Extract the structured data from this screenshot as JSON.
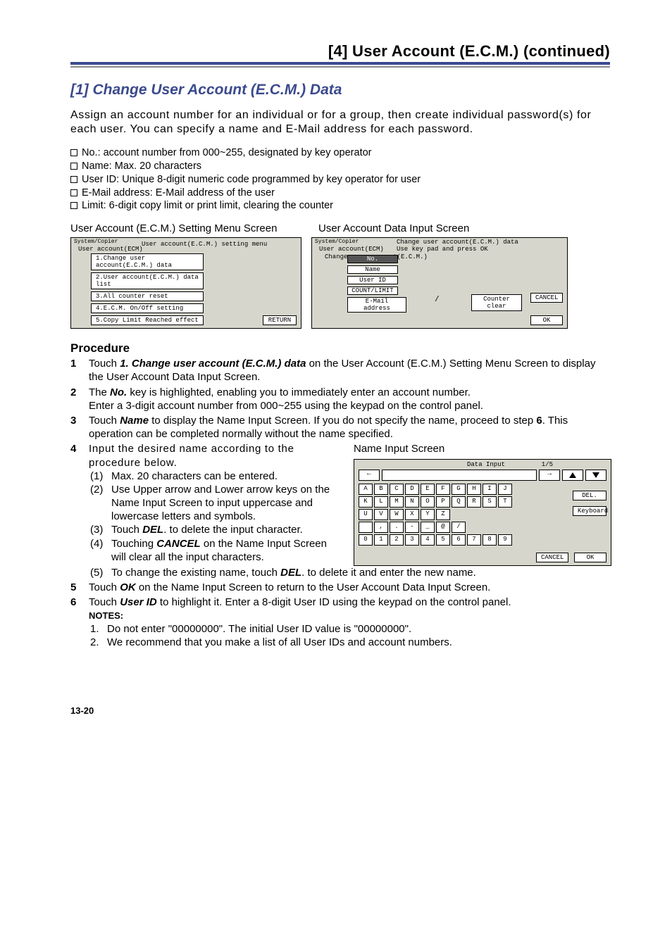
{
  "header": {
    "title": "[4] User Account (E.C.M.) (continued)"
  },
  "section_title": "[1] Change User Account (E.C.M.) Data",
  "intro": "Assign an account number for an individual or for a group, then create individual password(s) for each user. You can specify a name and E-Mail address for each password.",
  "bullets": [
    "No.: account number from 000~255, designated by key operator",
    "Name: Max. 20 characters",
    "User ID: Unique 8-digit numeric code programmed by key operator for user",
    "E-Mail address: E-Mail address of the user",
    "Limit: 6-digit copy limit or print limit, clearing the counter"
  ],
  "screen_labels": {
    "left": "User Account (E.C.M.) Setting Menu Screen",
    "right": "User Account Data Input Screen"
  },
  "screen1": {
    "bc1": "System/Copier",
    "bc2": "User account(ECM)",
    "title": "User account(E.C.M.) setting menu",
    "items": [
      "1.Change user account(E.C.M.) data",
      "2.User account(E.C.M.) data list",
      "3.All counter reset",
      "4.E.C.M. On/Off setting",
      "5.Copy Limit Reached effect"
    ],
    "return": "RETURN"
  },
  "screen2": {
    "bc1": "System/Copier",
    "bc2": "User account(ECM)",
    "bc3": "Change user account(E.C.M.)",
    "hdr1": "Change user account(E.C.M.) data",
    "hdr2": "Use key pad and press OK",
    "labels": {
      "no": "No.",
      "name": "Name",
      "user_id": "User ID",
      "count_limit": "COUNT/LIMIT",
      "email": "E-Mail address"
    },
    "slash": "/",
    "counter_clear": "Counter clear",
    "cancel": "CANCEL",
    "ok": "OK"
  },
  "procedure_head": "Procedure",
  "steps": {
    "s1": {
      "n": "1",
      "pre": "Touch ",
      "bold": "1. Change user account (E.C.M.) data",
      "post": " on the User Account (E.C.M.) Setting Menu Screen to display the User Account Data Input Screen."
    },
    "s2": {
      "n": "2",
      "pre": "The ",
      "bold": "No.",
      "mid": " key is highlighted, enabling you to immediately enter an account number.",
      "line2": "Enter a 3-digit account number from 000~255 using the keypad on the control panel."
    },
    "s3": {
      "n": "3",
      "pre": "Touch ",
      "bold": "Name",
      "mid": " to display the Name Input Screen. If you do not specify the name, proceed to step ",
      "six": "6",
      "post": ". This operation can be completed normally without the name specified."
    },
    "s4": {
      "n": "4",
      "text": "Input the desired name according to the procedure below."
    },
    "s5a": {
      "n": "5",
      "pre": "Touch ",
      "bold": "OK",
      "post": " on the Name Input Screen to return to the User Account Data Input Screen."
    },
    "s6": {
      "n": "6",
      "pre": "Touch ",
      "bold": "User ID",
      "post": " to highlight it. Enter a 8-digit User ID using the keypad on the control panel."
    }
  },
  "substeps": {
    "i1": {
      "n": "(1)",
      "t": "Max. 20 characters can be entered."
    },
    "i2": {
      "n": "(2)",
      "t": "Use Upper arrow and Lower arrow keys on the Name Input Screen to input uppercase and lowercase letters and symbols."
    },
    "i3": {
      "n": "(3)",
      "pre": "Touch ",
      "bold": "DEL",
      "post": ". to delete the input character."
    },
    "i4": {
      "n": "(4)",
      "pre": "Touching ",
      "bold": "CANCEL",
      "post": " on the Name Input Screen will clear all the input characters."
    },
    "i5": {
      "n": "(5)",
      "pre": "To change the existing name, touch ",
      "bold": "DEL",
      "post": ". to delete it and enter the new name."
    }
  },
  "name_input_label": "Name Input Screen",
  "screen3": {
    "title": "Data Input",
    "page": "1/5",
    "left_arrow": "←",
    "right_arrow": "→",
    "rows": [
      [
        "A",
        "B",
        "C",
        "D",
        "E",
        "F",
        "G",
        "H",
        "I",
        "J"
      ],
      [
        "K",
        "L",
        "M",
        "N",
        "O",
        "P",
        "Q",
        "R",
        "S",
        "T"
      ],
      [
        "U",
        "V",
        "W",
        "X",
        "Y",
        "Z"
      ],
      [
        " ",
        ",",
        ".",
        "-",
        "_",
        "@",
        "/"
      ],
      [
        "0",
        "1",
        "2",
        "3",
        "4",
        "5",
        "6",
        "7",
        "8",
        "9"
      ]
    ],
    "del": "DEL.",
    "keyboard": "Keyboard",
    "cancel": "CANCEL",
    "ok": "OK"
  },
  "notes_head": "NOTES:",
  "notes": {
    "n1": "Do not enter \"00000000\". The initial User ID value is \"00000000\".",
    "n2": "We recommend that you make a list of all User IDs and account numbers."
  },
  "page_number": "13-20"
}
